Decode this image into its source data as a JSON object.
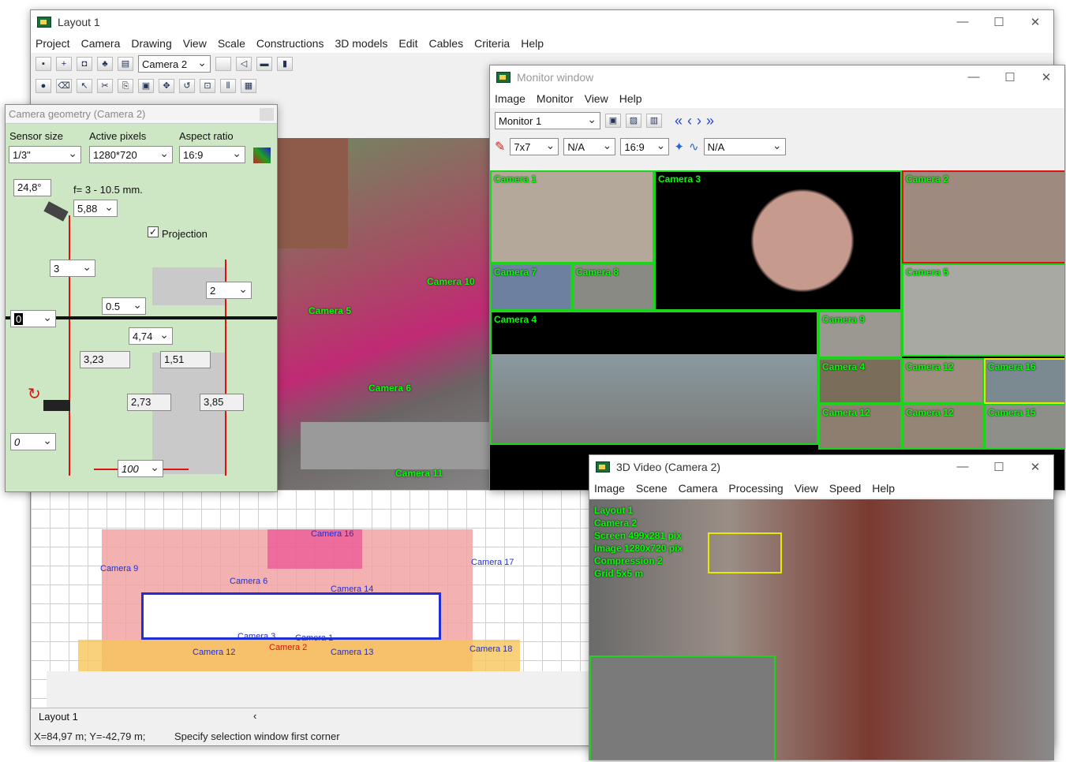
{
  "main_window": {
    "title": "Layout 1",
    "menu": [
      "Project",
      "Camera",
      "Drawing",
      "View",
      "Scale",
      "Constructions",
      "3D models",
      "Edit",
      "Cables",
      "Criteria",
      "Help"
    ],
    "camera_select": "Camera 2",
    "plan_labels": [
      "Camera 16",
      "Camera 17",
      "Camera 9",
      "Camera 6",
      "Camera 14",
      "Camera 12",
      "Camera 2",
      "Camera 13",
      "Camera 18",
      "Camera 3",
      "Camera 1"
    ],
    "scene_labels": [
      "Camera 5",
      "Camera 6",
      "Camera 10",
      "Camera 11"
    ],
    "tab": "Layout 1",
    "coords": "X=84,97 m; Y=-42,79 m;",
    "status": "Specify selection window first corner"
  },
  "camera_geometry": {
    "title": "Camera geometry (Camera 2)",
    "labels": {
      "sensor": "Sensor size",
      "pixels": "Active pixels",
      "aspect": "Aspect ratio"
    },
    "sensor": "1/3\"",
    "pixels": "1280*720",
    "aspect": "16:9",
    "angle": "24,8°",
    "focal_range": "f= 3 - 10.5 mm.",
    "focal": "5,88",
    "projection": "Projection",
    "height": "3",
    "right_height": "2",
    "tilt": "0.5",
    "zero": "0",
    "distance": "4,74",
    "w1": "3,23",
    "w2": "1,51",
    "w3": "2,73",
    "w4": "3,85",
    "rotation": "0",
    "percent": "100"
  },
  "monitor_window": {
    "title": "Monitor window",
    "menu": [
      "Image",
      "Monitor",
      "View",
      "Help"
    ],
    "monitor": "Monitor 1",
    "grid": "7x7",
    "na1": "N/A",
    "aspect": "16:9",
    "na2": "N/A",
    "tiles": [
      "Camera 1",
      "Camera 3",
      "Camera 2",
      "Camera 7",
      "Camera 8",
      "Camera 5",
      "Camera 4",
      "Camera 9",
      "Camera 4",
      "Camera 12",
      "Camera 16",
      "Camera 12",
      "Camera 12",
      "Camera 15"
    ]
  },
  "video_window": {
    "title": "3D Video (Camera 2)",
    "menu": [
      "Image",
      "Scene",
      "Camera",
      "Processing",
      "View",
      "Speed",
      "Help"
    ],
    "overlay": [
      "Layout 1",
      "Camera 2",
      "Screen 499x281 pix",
      "Image 1280x720 pix",
      "Compression 2",
      "Grid 5x5 m"
    ]
  }
}
